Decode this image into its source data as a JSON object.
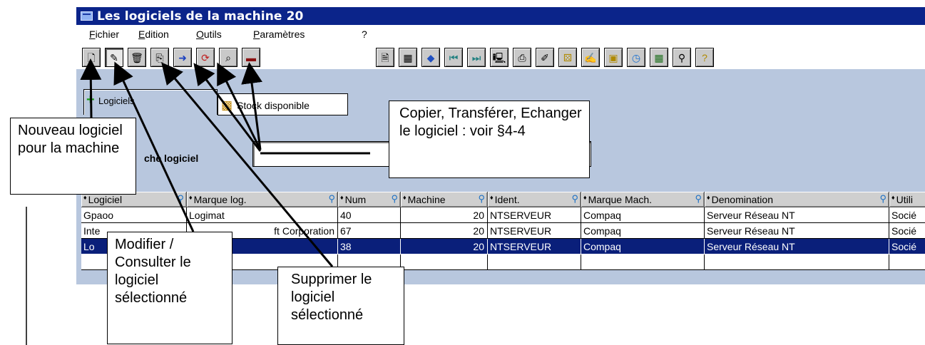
{
  "window": {
    "title": "Les logiciels de la machine 20"
  },
  "menu": {
    "fichier": "Fichier",
    "edition": "Edition",
    "outils": "Outils",
    "parametres": "Paramètres",
    "help": "?"
  },
  "tabs": {
    "logiciels": "Logiciels",
    "stock": "Stock disponible"
  },
  "search": {
    "label": "che logiciel",
    "value": ""
  },
  "table": {
    "columns": [
      "Logiciel",
      "Marque log.",
      "Num",
      "Machine",
      "Ident.",
      "Marque Mach.",
      "Denomination",
      "Utili"
    ],
    "rows": [
      [
        "Gpaoo",
        "Logimat",
        "40",
        "20",
        "NTSERVEUR",
        "Compaq",
        "Serveur Réseau NT",
        "Socié"
      ],
      [
        "Inte",
        "ft Corporation",
        "67",
        "20",
        "NTSERVEUR",
        "Compaq",
        "Serveur Réseau NT",
        "Socié"
      ],
      [
        "Lo",
        "",
        "38",
        "20",
        "NTSERVEUR",
        "Compaq",
        "Serveur Réseau NT",
        "Socié"
      ]
    ],
    "selected_row": 2
  },
  "callouts": {
    "nouveau": "Nouveau logiciel pour la machine",
    "copier": "Copier, Transférer, Echanger le logiciel : voir §4-4",
    "modifier": "Modifier / Consulter le logiciel sélectionné",
    "supprimer": "Supprimer le logiciel sélectionné"
  },
  "colors": {
    "titlebar": "#0b248a",
    "window_bg": "#b8c7de",
    "selected_row": "#0a1f7a"
  },
  "icons": [
    "new-document-icon",
    "edit-icon",
    "delete-icon",
    "copy-icon",
    "transfer-icon",
    "exchange-icon",
    "binoculars-icon",
    "memory-icon",
    "print-icon",
    "help-icon"
  ]
}
